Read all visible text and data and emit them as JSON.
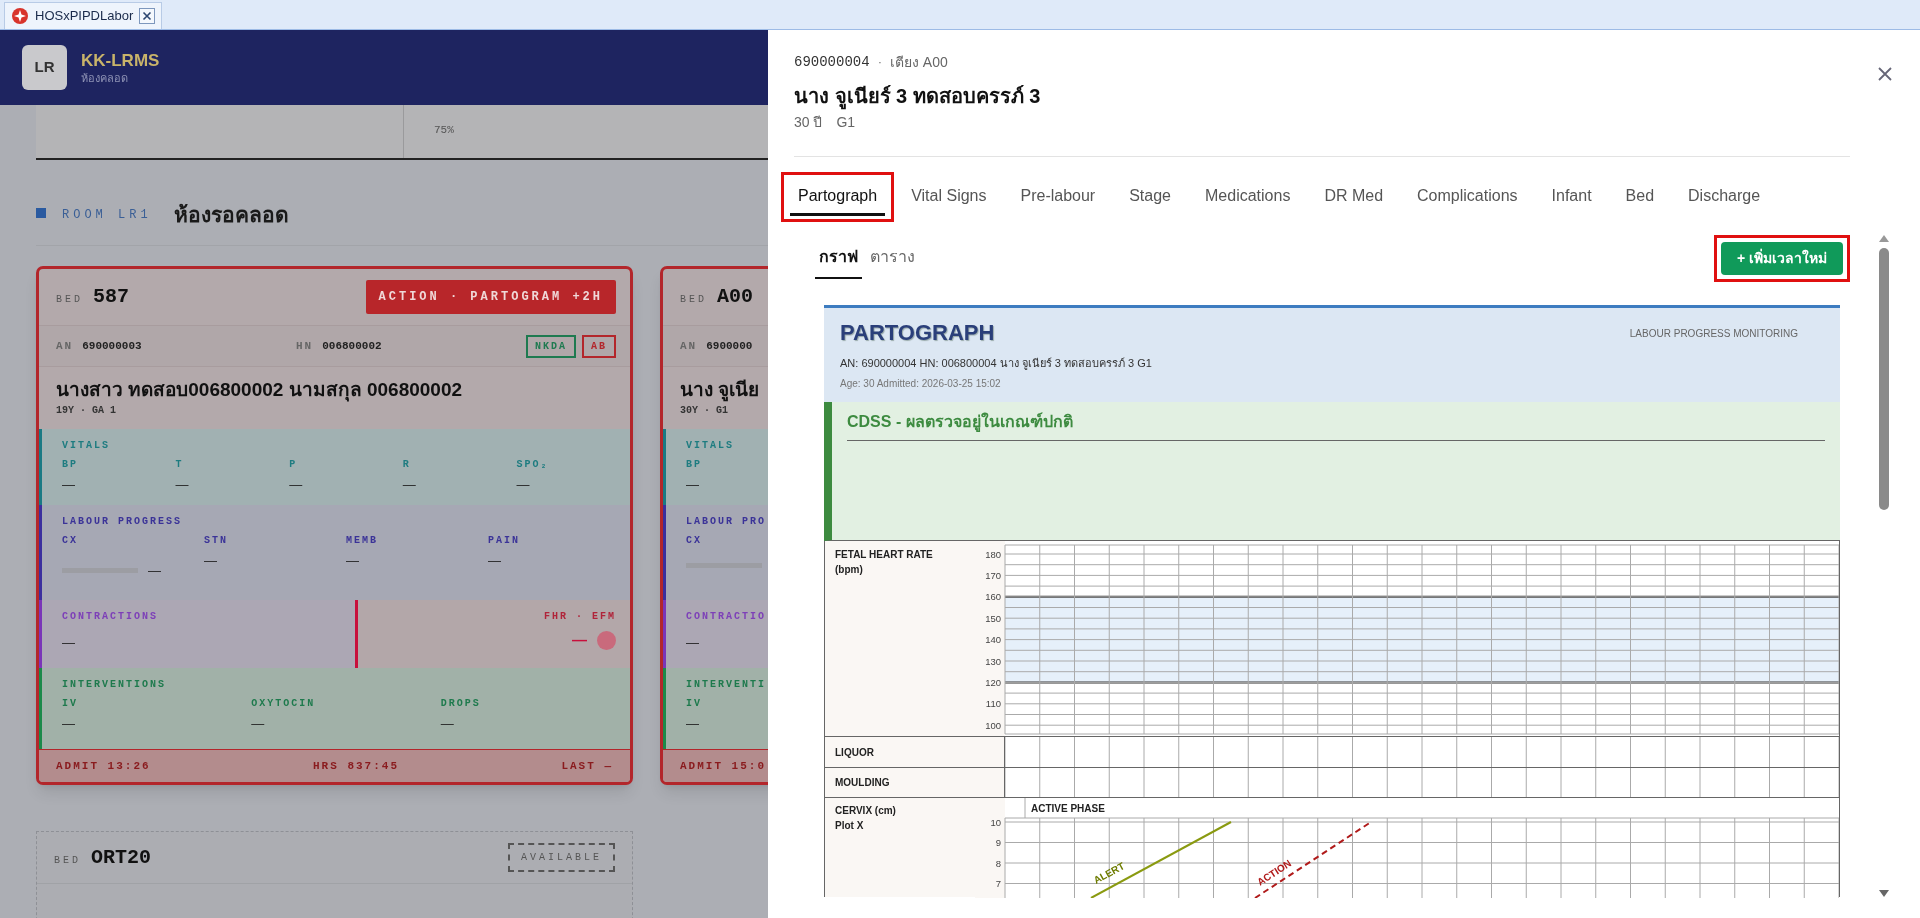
{
  "browser_tab": {
    "title": "HOSxPIPDLabor"
  },
  "app_header": {
    "logo": "LR",
    "title": "KK-LRMS",
    "subtitle": "ห้องคลอด"
  },
  "summary_strip": {
    "value": "75%"
  },
  "room": {
    "code": "ROOM LR1",
    "name": "ห้องรอคลอด"
  },
  "beds": [
    {
      "kind": "occupied",
      "bed_label": "BED",
      "bed": "587",
      "alert": "ACTION · PARTOGRAM +2H",
      "an_label": "AN",
      "an": "690000003",
      "hn_label": "HN",
      "hn": "006800002",
      "tags": [
        {
          "text": "NKDA",
          "color": "#1e7a50"
        },
        {
          "text": "AB",
          "color": "#b3262b"
        }
      ],
      "name": "นางสาว ทดสอบ006800002 นามสกุล 006800002",
      "meta": "19Y · GA 1",
      "vitals": {
        "title": "VITALS",
        "fields": [
          {
            "label": "BP",
            "value": "—"
          },
          {
            "label": "T",
            "value": "—"
          },
          {
            "label": "P",
            "value": "—"
          },
          {
            "label": "R",
            "value": "—"
          },
          {
            "label": "SPO₂",
            "value": "—"
          }
        ]
      },
      "labour": {
        "title": "LABOUR PROGRESS",
        "fields": [
          {
            "label": "CX",
            "value": "—",
            "level": 0
          },
          {
            "label": "STN",
            "value": "—"
          },
          {
            "label": "MEMB",
            "value": "—"
          },
          {
            "label": "PAIN",
            "value": "—"
          }
        ]
      },
      "contractions": {
        "title": "CONTRACTIONS",
        "value": "—"
      },
      "fhr": {
        "title": "FHR · EFM",
        "value": "—"
      },
      "interventions": {
        "title": "INTERVENTIONS",
        "fields": [
          {
            "label": "IV",
            "value": "—"
          },
          {
            "label": "OXYTOCIN",
            "value": "—"
          },
          {
            "label": "DROPS",
            "value": "—"
          }
        ]
      },
      "footer": [
        "ADMIT 13:26",
        "HRS 837:45",
        "LAST —"
      ]
    },
    {
      "kind": "occupied",
      "bed_label": "BED",
      "bed": "A00",
      "an_label": "AN",
      "an": "6900000",
      "name": "นาง จูเนีย",
      "meta": "30Y · G1",
      "vitals": {
        "title": "VITALS",
        "fields": [
          {
            "label": "BP",
            "value": "—"
          }
        ]
      },
      "labour": {
        "title": "LABOUR PRO",
        "fields": [
          {
            "label": "CX",
            "level": 0
          }
        ]
      },
      "contractions": {
        "title": "CONTRACTIO",
        "value": "—"
      },
      "interventions": {
        "title": "INTERVENTI",
        "fields": [
          {
            "label": "IV",
            "value": "—"
          }
        ]
      },
      "footer": [
        "ADMIT 15:0"
      ]
    },
    {
      "kind": "available",
      "bed_label": "BED",
      "bed": "ORT20",
      "status": "AVAILABLE"
    }
  ],
  "drawer": {
    "an": "690000004",
    "separator": "·",
    "bed": "เตียง A00",
    "name": "นาง จูเนียร์ 3 ทดสอบครรภ์ 3",
    "age": "30 ปี",
    "gravida": "G1",
    "tabs": [
      {
        "label": "Partograph",
        "selected": true,
        "highlighted": true
      },
      {
        "label": "Vital Signs",
        "selected": false,
        "highlighted": false
      },
      {
        "label": "Pre-labour",
        "selected": false,
        "highlighted": false
      },
      {
        "label": "Stage",
        "selected": false,
        "highlighted": false
      },
      {
        "label": "Medications",
        "selected": false,
        "highlighted": false
      },
      {
        "label": "DR Med",
        "selected": false,
        "highlighted": false
      },
      {
        "label": "Complications",
        "selected": false,
        "highlighted": false
      },
      {
        "label": "Infant",
        "selected": false,
        "highlighted": false
      },
      {
        "label": "Bed",
        "selected": false,
        "highlighted": false
      },
      {
        "label": "Discharge",
        "selected": false,
        "highlighted": false
      }
    ],
    "subtabs": [
      {
        "label": "กราฟ",
        "selected": true
      },
      {
        "label": "ตาราง",
        "selected": false
      }
    ],
    "add_button": {
      "label": "+ เพิ่มเวลาใหม่",
      "highlighted": true
    },
    "partograph": {
      "title": "PARTOGRAPH",
      "subtitle": "LABOUR PROGRESS MONITORING",
      "info": "AN: 690000004 HN: 006800004 นาง จูเนียร์ 3 ทดสอบครรภ์ 3 G1",
      "admitted": "Age: 30 Admitted: 2026-03-25 15:02",
      "cdss": "CDSS - ผลตรวจอยู่ในเกณฑ์ปกติ",
      "fhr": {
        "label": "FETAL HEART RATE (bpm)",
        "ticks": [
          "180",
          "170",
          "160",
          "150",
          "140",
          "130",
          "120",
          "110",
          "100"
        ]
      },
      "liquor": "LIQUOR",
      "moulding": "MOULDING",
      "cervix": {
        "label_lines": [
          "CERVIX (cm)",
          "Plot X"
        ],
        "phase": "ACTIVE PHASE",
        "ticks": [
          "10",
          "9",
          "8",
          "7"
        ],
        "alert": "ALERT",
        "action": "ACTION"
      }
    }
  }
}
